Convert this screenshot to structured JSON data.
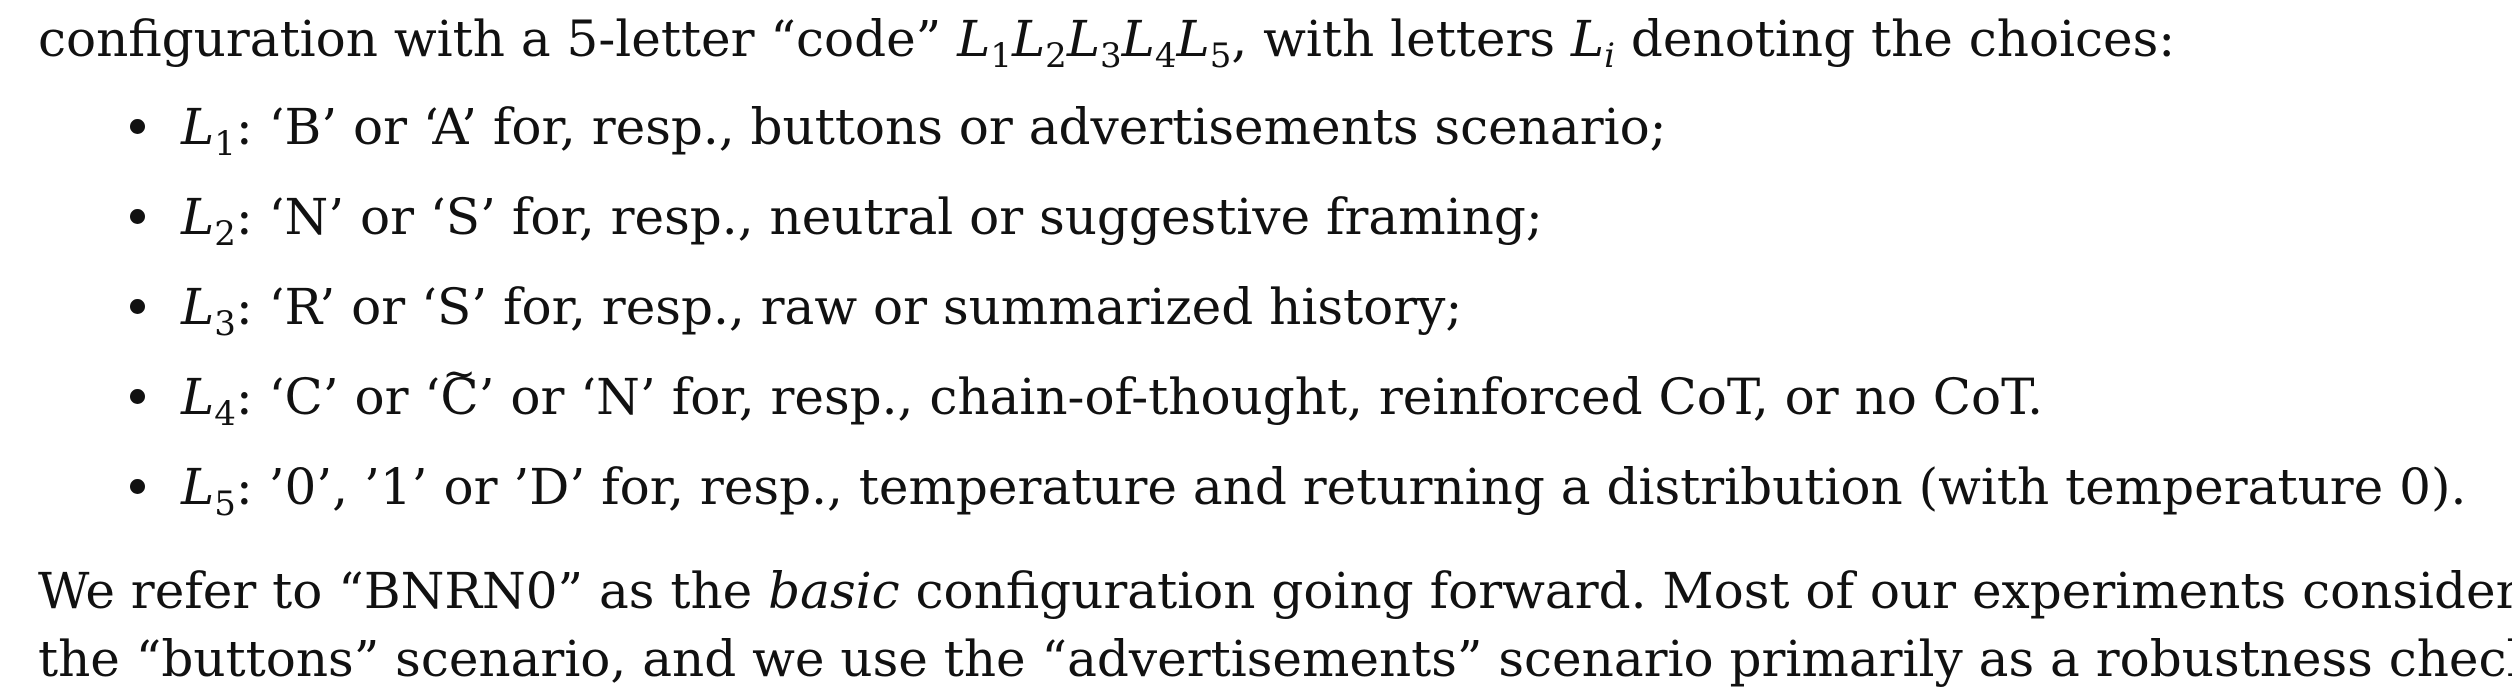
{
  "intro": {
    "before": "configuration with a 5-letter “code” ",
    "code_letters": [
      {
        "base": "L",
        "sub": "1"
      },
      {
        "base": "L",
        "sub": "2"
      },
      {
        "base": "L",
        "sub": "3"
      },
      {
        "base": "L",
        "sub": "4"
      },
      {
        "base": "L",
        "sub": "5"
      }
    ],
    "middle": ", with letters ",
    "var_base": "L",
    "var_sub": "i",
    "after": " denoting the choices:"
  },
  "bullets": [
    {
      "base": "L",
      "sub": "1",
      "text": ": ‘B’ or ‘A’ for, resp., buttons or advertisements scenario;"
    },
    {
      "base": "L",
      "sub": "2",
      "text": ": ‘N’ or ‘S’ for, resp., neutral or suggestive framing;"
    },
    {
      "base": "L",
      "sub": "3",
      "text": ": ‘R’ or ‘S’ for, resp., raw or summarized history;"
    },
    {
      "base": "L",
      "sub": "4",
      "pre": ": ‘C’ or ‘",
      "tilde_letter": "C",
      "tilde_mark": "~",
      "post": "’ or ‘N’ for, resp., chain-of-thought, reinforced CoT, or no CoT."
    },
    {
      "base": "L",
      "sub": "5",
      "text": ": ’0’, ’1’ or ’D’ for, resp., temperature and returning a distribution (with temperature 0)."
    }
  ],
  "outro": {
    "line1_before": "We refer to “BNRN0” as the ",
    "line1_em": "basic",
    "line1_after": " configuration going forward. Most of our experiments consider",
    "line2": "the “buttons” scenario, and we use the “advertisements” scenario primarily as a robustness check."
  }
}
